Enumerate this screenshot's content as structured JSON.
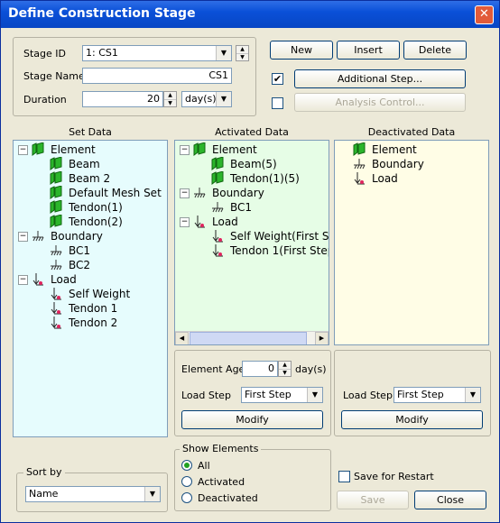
{
  "window": {
    "title": "Define Construction Stage",
    "close_glyph": "✕"
  },
  "stage": {
    "id_label": "Stage ID",
    "id_value": "1: CS1",
    "name_label": "Stage Name",
    "name_value": "CS1",
    "duration_label": "Duration",
    "duration_value": "20",
    "duration_unit": "day(s)"
  },
  "buttons": {
    "new": "New",
    "insert": "Insert",
    "delete": "Delete",
    "additional_step": "Additional Step...",
    "analysis_control": "Analysis Control...",
    "modify": "Modify",
    "save": "Save",
    "close": "Close"
  },
  "checks": {
    "additional_step_checked": "✔"
  },
  "columns": {
    "set": "Set Data",
    "activated": "Activated Data",
    "deactivated": "Deactivated Data"
  },
  "set_tree": {
    "element": "Element",
    "beam": "Beam",
    "beam2": "Beam 2",
    "default_mesh_set": "Default Mesh Set",
    "tendon1": "Tendon(1)",
    "tendon2": "Tendon(2)",
    "boundary": "Boundary",
    "bc1": "BC1",
    "bc2": "BC2",
    "load": "Load",
    "self_weight": "Self Weight",
    "tendon_1": "Tendon 1",
    "tendon_2": "Tendon 2"
  },
  "activated_tree": {
    "element": "Element",
    "beam5": "Beam(5)",
    "tendon15": "Tendon(1)(5)",
    "boundary": "Boundary",
    "bc1": "BC1",
    "load": "Load",
    "self_weight": "Self Weight(First St",
    "tendon1": "Tendon 1(First Step"
  },
  "deactivated_tree": {
    "element": "Element",
    "boundary": "Boundary",
    "load": "Load"
  },
  "activated_opts": {
    "element_age_label": "Element Age",
    "element_age_value": "0",
    "element_age_unit": "day(s)",
    "load_step_label": "Load Step",
    "load_step_value": "First Step"
  },
  "deactivated_opts": {
    "load_step_label": "Load Step",
    "load_step_value": "First Step"
  },
  "sort": {
    "label": "Sort by",
    "value": "Name"
  },
  "show": {
    "label": "Show Elements",
    "all": "All",
    "activated": "Activated",
    "deactivated": "Deactivated",
    "selected": "All"
  },
  "save_restart_label": "Save for Restart",
  "colors": {
    "set_bg": "#e6fcfd",
    "activated_bg": "#e6fde6",
    "deactivated_bg": "#fffde6",
    "accent": "#0a50d8"
  }
}
